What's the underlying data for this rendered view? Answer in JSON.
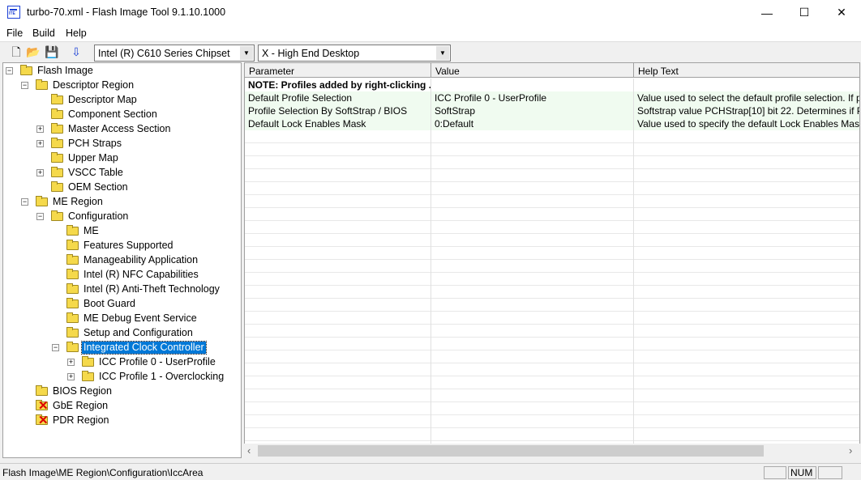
{
  "window": {
    "title": "turbo-70.xml - Flash Image Tool 9.1.10.1000",
    "minimize": "—",
    "maximize": "☐",
    "close": "✕"
  },
  "menu": [
    "File",
    "Build",
    "Help"
  ],
  "toolbar": {
    "chipset": "Intel (R) C610 Series Chipset",
    "sku": "X - High End Desktop",
    "icons": [
      "new-file-icon",
      "open-folder-icon",
      "save-icon",
      "build-image-icon"
    ]
  },
  "tree": [
    {
      "label": "Flash Image",
      "level": 0,
      "exp": "-",
      "icon": "folder-open"
    },
    {
      "label": "Descriptor Region",
      "level": 1,
      "exp": "-",
      "icon": "folder-open"
    },
    {
      "label": "Descriptor Map",
      "level": 2,
      "exp": "",
      "icon": "folder"
    },
    {
      "label": "Component Section",
      "level": 2,
      "exp": "",
      "icon": "folder"
    },
    {
      "label": "Master Access Section",
      "level": 2,
      "exp": "+",
      "icon": "folder"
    },
    {
      "label": "PCH Straps",
      "level": 2,
      "exp": "+",
      "icon": "folder"
    },
    {
      "label": "Upper Map",
      "level": 2,
      "exp": "",
      "icon": "folder"
    },
    {
      "label": "VSCC Table",
      "level": 2,
      "exp": "+",
      "icon": "folder"
    },
    {
      "label": "OEM Section",
      "level": 2,
      "exp": "",
      "icon": "folder"
    },
    {
      "label": "ME Region",
      "level": 1,
      "exp": "-",
      "icon": "folder-open"
    },
    {
      "label": "Configuration",
      "level": 2,
      "exp": "-",
      "icon": "folder-open"
    },
    {
      "label": "ME",
      "level": 3,
      "exp": "",
      "icon": "folder"
    },
    {
      "label": "Features Supported",
      "level": 3,
      "exp": "",
      "icon": "folder"
    },
    {
      "label": "Manageability Application",
      "level": 3,
      "exp": "",
      "icon": "folder"
    },
    {
      "label": "Intel (R) NFC Capabilities",
      "level": 3,
      "exp": "",
      "icon": "folder"
    },
    {
      "label": "Intel (R) Anti-Theft Technology",
      "level": 3,
      "exp": "",
      "icon": "folder"
    },
    {
      "label": "Boot Guard",
      "level": 3,
      "exp": "",
      "icon": "folder"
    },
    {
      "label": "ME Debug Event Service",
      "level": 3,
      "exp": "",
      "icon": "folder"
    },
    {
      "label": "Setup and Configuration",
      "level": 3,
      "exp": "",
      "icon": "folder"
    },
    {
      "label": "Integrated Clock Controller",
      "level": 3,
      "exp": "-",
      "icon": "folder-open",
      "selected": true
    },
    {
      "label": "ICC Profile 0 - UserProfile",
      "level": 4,
      "exp": "+",
      "icon": "folder"
    },
    {
      "label": "ICC Profile 1 - Overclocking",
      "level": 4,
      "exp": "+",
      "icon": "folder"
    },
    {
      "label": "BIOS Region",
      "level": 1,
      "exp": "",
      "icon": "folder"
    },
    {
      "label": "GbE Region",
      "level": 1,
      "exp": "",
      "icon": "disabled-x"
    },
    {
      "label": "PDR Region",
      "level": 1,
      "exp": "",
      "icon": "disabled-x"
    }
  ],
  "grid": {
    "columns": [
      "Parameter",
      "Value",
      "Help Text"
    ],
    "rows": [
      {
        "param": "NOTE: Profiles added by right-clicking ...",
        "value": "",
        "help": "",
        "bold": true
      },
      {
        "param": "Default Profile Selection",
        "value": "ICC Profile 0 - UserProfile",
        "help": "Value used to select the default profile selection.  If p"
      },
      {
        "param": "Profile Selection By SoftStrap / BIOS",
        "value": "SoftStrap",
        "help": "Softstrap value PCHStrap[10] bit 22. Determines if Pr"
      },
      {
        "param": "Default Lock Enables Mask",
        "value": "0:Default",
        "help": "Value used to specify the default Lock Enables Mask"
      }
    ]
  },
  "scroll": {
    "left": "‹",
    "right": "›"
  },
  "status": {
    "path": "Flash Image\\ME Region\\Configuration\\IccArea",
    "num": "NUM"
  }
}
